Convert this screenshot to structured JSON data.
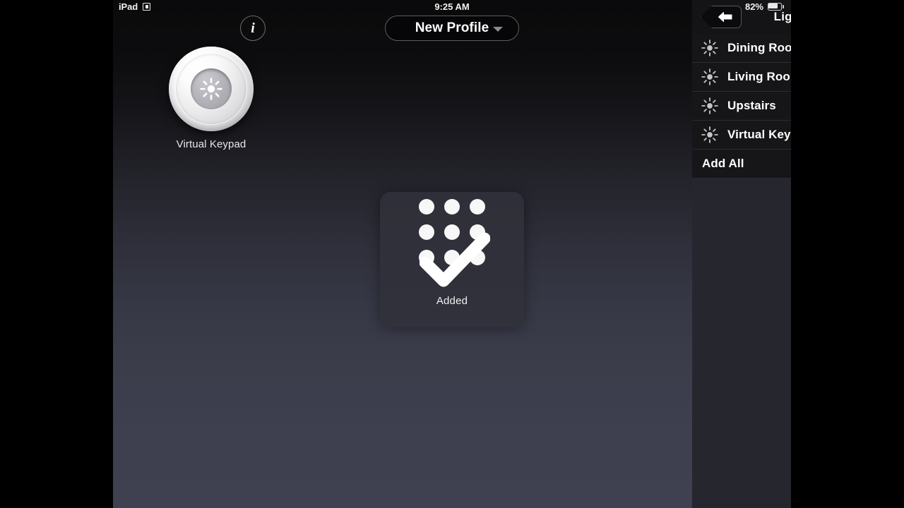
{
  "status_bar": {
    "device": "iPad",
    "device_glyph_icon": "screen-rotation-lock-icon",
    "time": "9:25 AM",
    "battery_percent": "82%",
    "battery_icon": "battery-icon"
  },
  "toolbar": {
    "info_icon": "info-icon",
    "info_label": "i",
    "profile_label": "New Profile",
    "profile_caret_icon": "chevron-down-icon"
  },
  "workspace": {
    "device": {
      "label": "Virtual Keypad",
      "icon": "brightness-sun-icon"
    }
  },
  "toast": {
    "label": "Added",
    "graphic_icon": "keypad-checkmark-icon",
    "dot_count": 9
  },
  "sidebar": {
    "back_icon": "back-arrow-icon",
    "title": "Lighting",
    "add_all_label": "Add All",
    "add_icon": "plus-circle-icon",
    "row_icon": "brightness-sun-icon",
    "items": [
      {
        "label": "Dining Room Dimm..."
      },
      {
        "label": "Living Room Dimmer"
      },
      {
        "label": "Upstairs"
      },
      {
        "label": "Virtual Keypad"
      }
    ]
  },
  "colors": {
    "accent_green": "#5bc236",
    "sidebar_bg": "#26262f",
    "row_bg": "#161619",
    "header_bg": "#141417",
    "canvas_top": "#0a0a0b",
    "canvas_bottom": "#3f4151",
    "toast_bg": "rgba(48,48,58,.93)"
  }
}
